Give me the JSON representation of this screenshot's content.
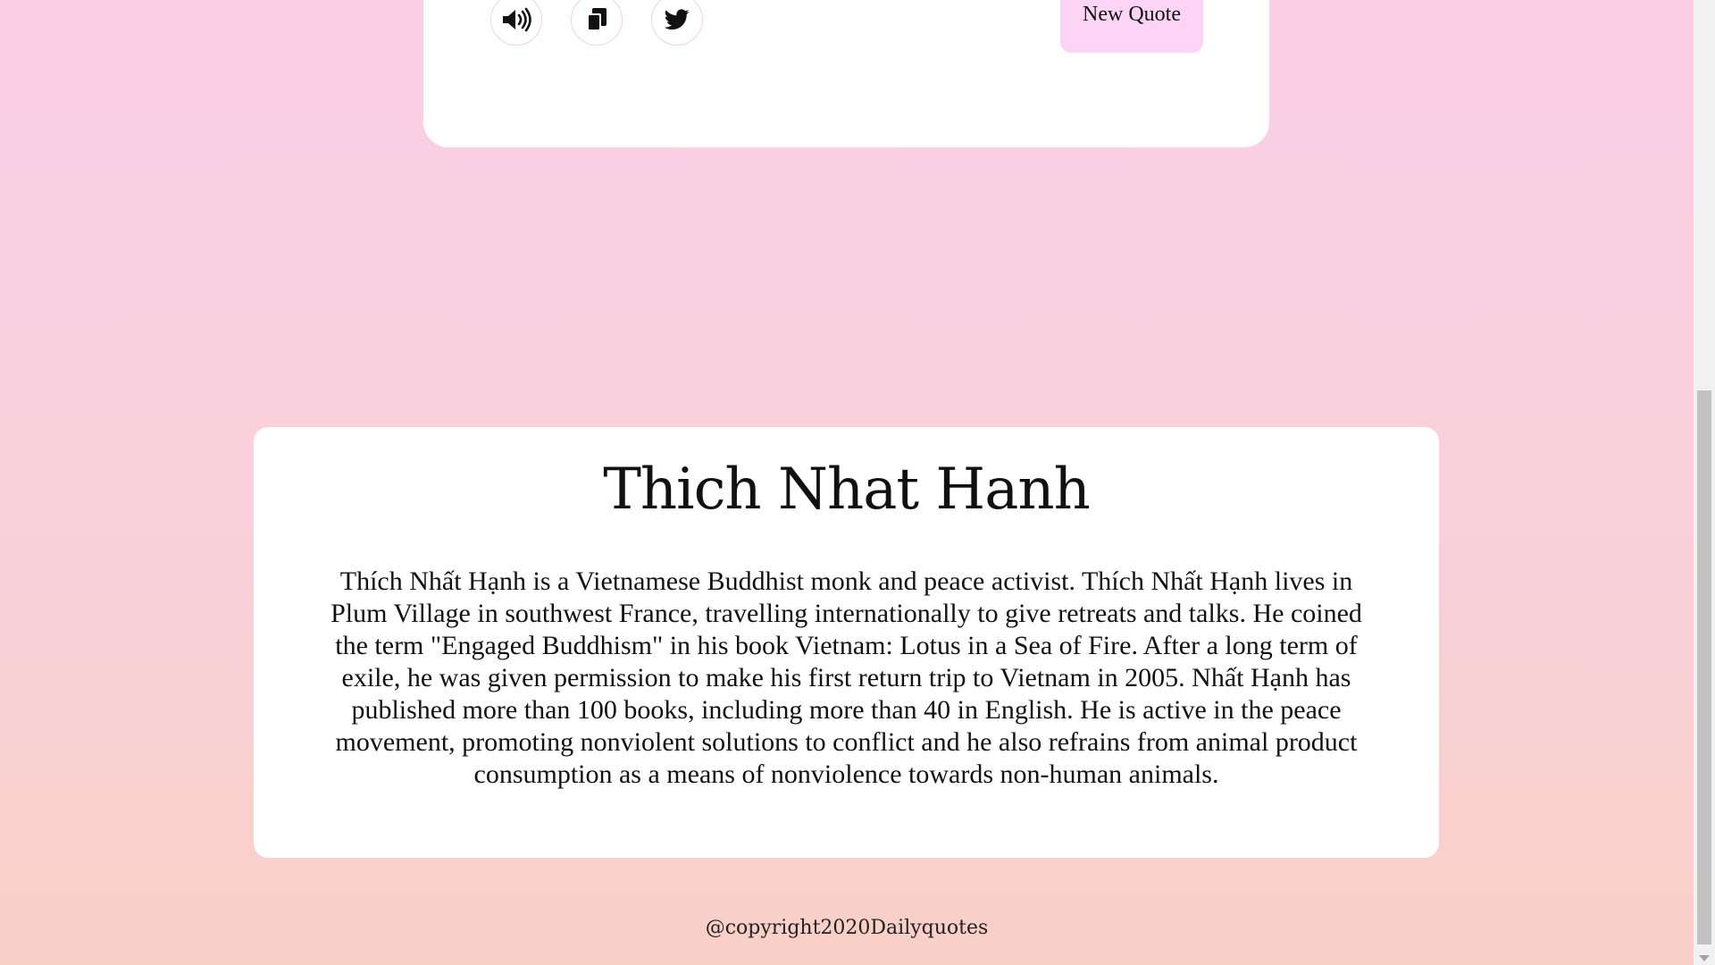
{
  "quote_card": {
    "buttons": {
      "speak_icon": "speaker-icon",
      "copy_icon": "copy-icon",
      "tweet_icon": "twitter-icon",
      "new_quote_label": "New Quote"
    }
  },
  "author": {
    "name": "Thich Nhat Hanh",
    "bio": "Thích Nhất Hạnh is a Vietnamese Buddhist monk and peace activist. Thích Nhất Hạnh lives in Plum Village in southwest France, travelling internationally to give retreats and talks. He coined the term \"Engaged Buddhism\" in his book Vietnam: Lotus in a Sea of Fire. After a long term of exile, he was given permission to make his first return trip to Vietnam in 2005. Nhất Hạnh has published more than 100 books, including more than 40 in English. He is active in the peace movement, promoting nonviolent solutions to conflict and he also refrains from animal product consumption as a means of nonviolence towards non-human animals."
  },
  "footer": {
    "copyright": "@copyright2020Dailyquotes"
  },
  "colors": {
    "background_top": "#fccfe6",
    "background_bottom": "#f9d0c6",
    "new_quote_button": "#fdd4f5",
    "card": "#ffffff"
  }
}
